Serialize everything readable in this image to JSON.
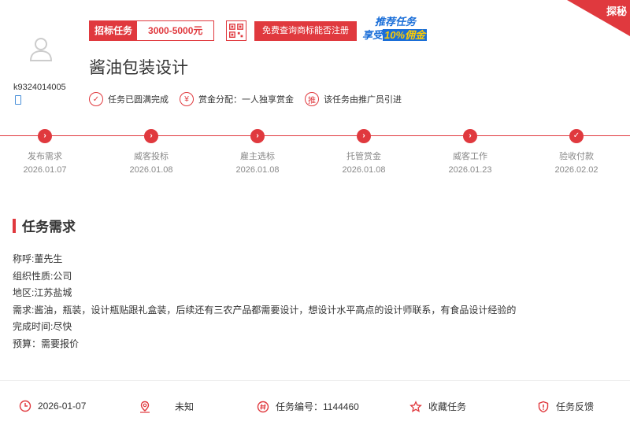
{
  "header": {
    "username": "k9324014005",
    "badge_label": "招标任务",
    "badge_value": "3000-5000元",
    "check_button": "免费查询商标能否注册",
    "promo_line1": "推荐任务",
    "promo_line2a": "享受",
    "promo_line2b": "10%佣金",
    "corner_label": "探秘",
    "title": "酱油包装设计",
    "features": [
      {
        "icon": "check-circle-icon",
        "glyph": "✓",
        "label": "任务已圆满完成"
      },
      {
        "icon": "yen-circle-icon",
        "glyph": "¥",
        "label": "赏金分配：一人独享赏金"
      },
      {
        "icon": "promote-circle-icon",
        "glyph": "推",
        "label": "该任务由推广员引进"
      }
    ]
  },
  "timeline": [
    {
      "name": "发布需求",
      "date": "2026.01.07",
      "glyph": "›"
    },
    {
      "name": "威客投标",
      "date": "2026.01.08",
      "glyph": "›"
    },
    {
      "name": "雇主选标",
      "date": "2026.01.08",
      "glyph": "›"
    },
    {
      "name": "托管赏金",
      "date": "2026.01.08",
      "glyph": "›"
    },
    {
      "name": "威客工作",
      "date": "2026.01.23",
      "glyph": "›"
    },
    {
      "name": "验收付款",
      "date": "2026.02.02",
      "glyph": "✓"
    }
  ],
  "requirements": {
    "section_title": "任务需求",
    "lines": [
      "称呼:董先生",
      "组织性质:公司",
      "地区:江苏盐城",
      "需求:酱油，瓶装，设计瓶贴跟礼盒装，后续还有三农产品都需要设计，想设计水平高点的设计师联系，有食品设计经验的",
      "完成时间:尽快",
      "预算：需要报价"
    ]
  },
  "footer": {
    "date": "2026-01-07",
    "location": "未知",
    "task_number": "任务编号：1144460",
    "favorite": "收藏任务",
    "feedback": "任务反馈"
  },
  "colors": {
    "accent": "#e0393e",
    "promo_blue": "#1a6ed8"
  }
}
